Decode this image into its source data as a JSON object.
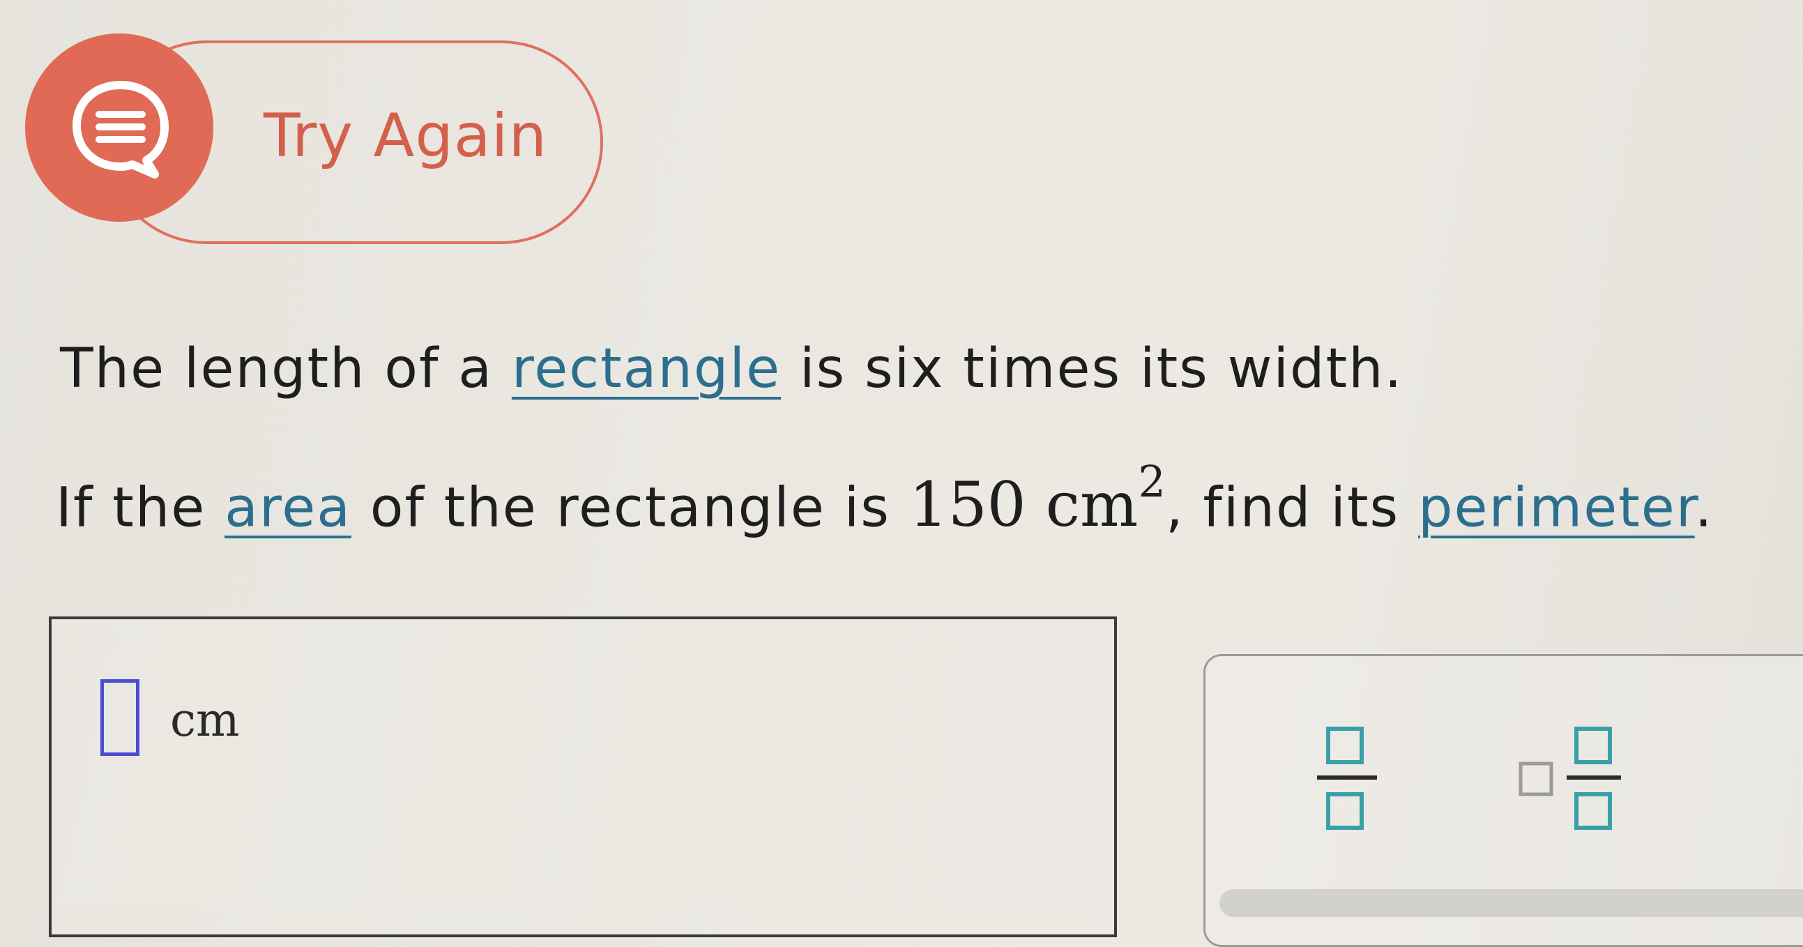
{
  "feedback": {
    "label": "Try Again",
    "icon": "speech-bubble-icon",
    "accent_color": "#e06a55"
  },
  "question": {
    "line1": {
      "before": "The length of a ",
      "link": "rectangle",
      "after": " is six times its width."
    },
    "line2": {
      "before": "If the ",
      "link_area": "area",
      "middle": " of the rectangle is ",
      "area_value": "150 cm",
      "area_exponent": "2",
      "after_math": ", find its ",
      "link_perimeter": "perimeter",
      "end": "."
    },
    "link_color": "#2c6e8e"
  },
  "answer": {
    "value": "",
    "unit": "cm"
  },
  "palette": {
    "buttons": [
      "fraction-button",
      "mixed-number-button"
    ]
  }
}
